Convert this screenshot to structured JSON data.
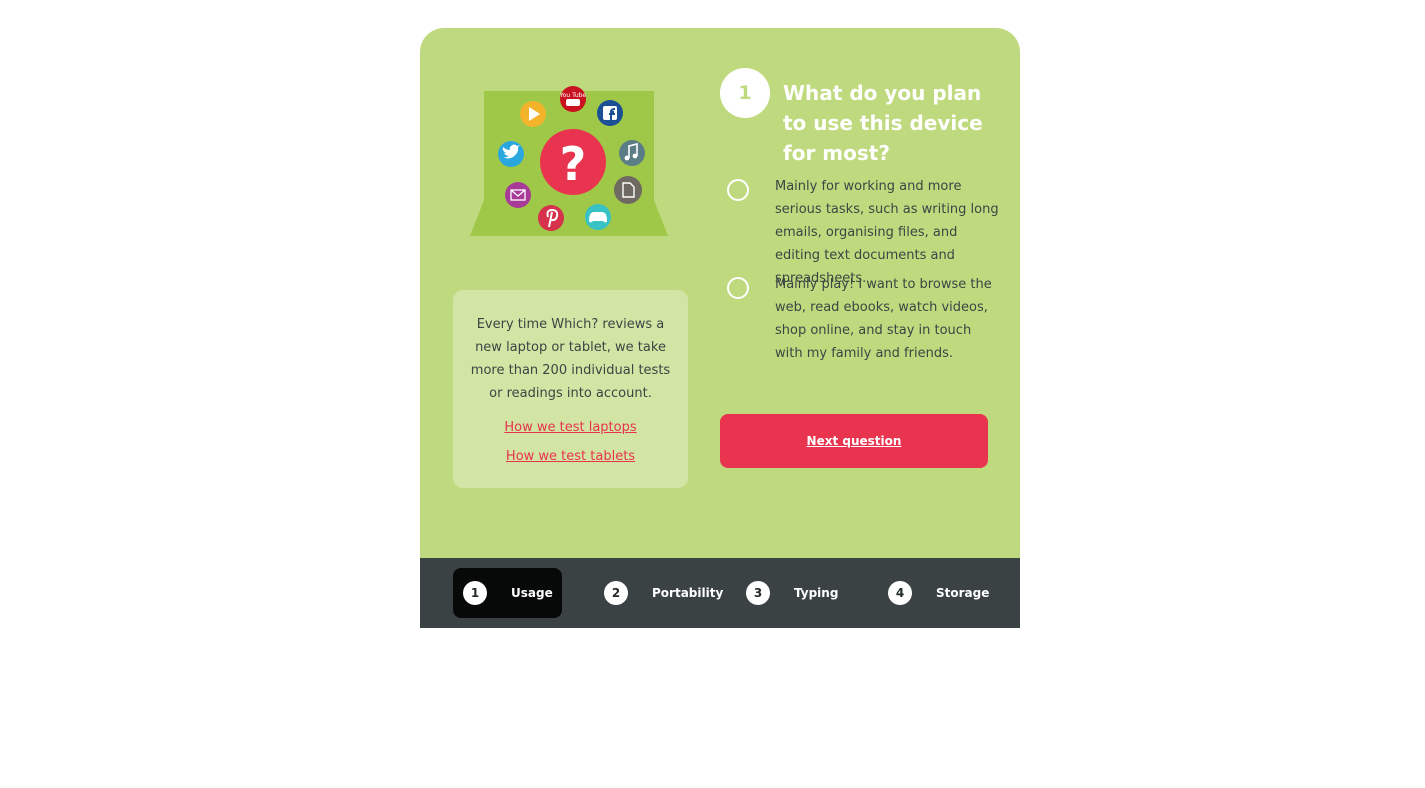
{
  "question": {
    "number": "1",
    "title": "What do you plan to use this device for most?",
    "options": [
      {
        "label": "Mainly for working and more serious tasks, such as writing long emails, organising files, and editing text documents and spreadsheets."
      },
      {
        "label": "Mainly play! I want to browse the web, read ebooks, watch videos, shop online, and stay in touch with my family and friends."
      }
    ],
    "next_label": "Next question"
  },
  "info": {
    "text": "Every time Which? reviews a new laptop or tablet, we take more than 200 individual tests or readings into account.",
    "link_laptops": "How we test laptops",
    "link_tablets": "How we test tablets"
  },
  "illustration": {
    "center_symbol": "?",
    "youtube_text": "You Tube",
    "icons": [
      "youtube-icon",
      "play-icon",
      "facebook-icon",
      "twitter-icon",
      "music-icon",
      "mail-icon",
      "document-icon",
      "pinterest-icon",
      "gamepad-icon"
    ]
  },
  "steps": [
    {
      "number": "1",
      "label": "Usage",
      "active": true
    },
    {
      "number": "2",
      "label": "Portability",
      "active": false
    },
    {
      "number": "3",
      "label": "Typing",
      "active": false
    },
    {
      "number": "4",
      "label": "Storage",
      "active": false
    }
  ],
  "colors": {
    "card_bg": "#bfda7e",
    "info_bg": "#d3e5a4",
    "accent_red": "#e8344f",
    "steps_bar": "#3a4244",
    "step_active": "#070808"
  }
}
